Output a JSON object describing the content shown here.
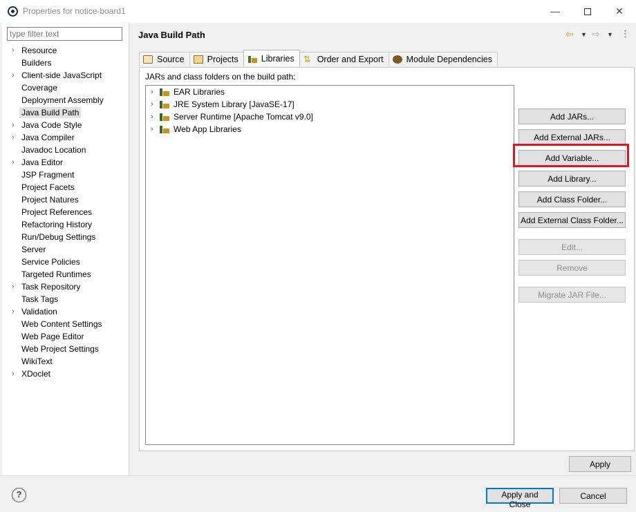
{
  "window": {
    "title": "Properties for notice-board1"
  },
  "filter": {
    "placeholder": "type filter text"
  },
  "nav": {
    "items": [
      {
        "label": "Resource",
        "expandable": true
      },
      {
        "label": "Builders",
        "expandable": false
      },
      {
        "label": "Client-side JavaScript",
        "expandable": true
      },
      {
        "label": "Coverage",
        "expandable": false
      },
      {
        "label": "Deployment Assembly",
        "expandable": false
      },
      {
        "label": "Java Build Path",
        "expandable": false,
        "selected": true
      },
      {
        "label": "Java Code Style",
        "expandable": true
      },
      {
        "label": "Java Compiler",
        "expandable": true
      },
      {
        "label": "Javadoc Location",
        "expandable": false
      },
      {
        "label": "Java Editor",
        "expandable": true
      },
      {
        "label": "JSP Fragment",
        "expandable": false
      },
      {
        "label": "Project Facets",
        "expandable": false
      },
      {
        "label": "Project Natures",
        "expandable": false
      },
      {
        "label": "Project References",
        "expandable": false
      },
      {
        "label": "Refactoring History",
        "expandable": false
      },
      {
        "label": "Run/Debug Settings",
        "expandable": false
      },
      {
        "label": "Server",
        "expandable": false
      },
      {
        "label": "Service Policies",
        "expandable": false
      },
      {
        "label": "Targeted Runtimes",
        "expandable": false
      },
      {
        "label": "Task Repository",
        "expandable": true
      },
      {
        "label": "Task Tags",
        "expandable": false
      },
      {
        "label": "Validation",
        "expandable": true
      },
      {
        "label": "Web Content Settings",
        "expandable": false
      },
      {
        "label": "Web Page Editor",
        "expandable": false
      },
      {
        "label": "Web Project Settings",
        "expandable": false
      },
      {
        "label": "WikiText",
        "expandable": false
      },
      {
        "label": "XDoclet",
        "expandable": true
      }
    ]
  },
  "page": {
    "title": "Java Build Path",
    "tabs": [
      {
        "label": "Source",
        "icon": "source-folder-icon"
      },
      {
        "label": "Projects",
        "icon": "projects-folder-icon"
      },
      {
        "label": "Libraries",
        "icon": "library-icon",
        "active": true
      },
      {
        "label": "Order and Export",
        "icon": "order-export-icon"
      },
      {
        "label": "Module Dependencies",
        "icon": "module-icon"
      }
    ],
    "build_path_label": "JARs and class folders on the build path:",
    "libraries": [
      "EAR Libraries",
      "JRE System Library [JavaSE-17]",
      "Server Runtime [Apache Tomcat v9.0]",
      "Web App Libraries"
    ],
    "buttons": {
      "add_jars": "Add JARs...",
      "add_external_jars": "Add External JARs...",
      "add_variable": "Add Variable...",
      "add_library": "Add Library...",
      "add_class_folder": "Add Class Folder...",
      "add_external_class_folder": "Add External Class Folder...",
      "edit": "Edit...",
      "remove": "Remove",
      "migrate_jar": "Migrate JAR File..."
    },
    "apply": "Apply"
  },
  "footer": {
    "apply_close": "Apply and Close",
    "cancel": "Cancel"
  },
  "colors": {
    "highlight": "#e0151f",
    "default_button_border": "#0078d7"
  }
}
